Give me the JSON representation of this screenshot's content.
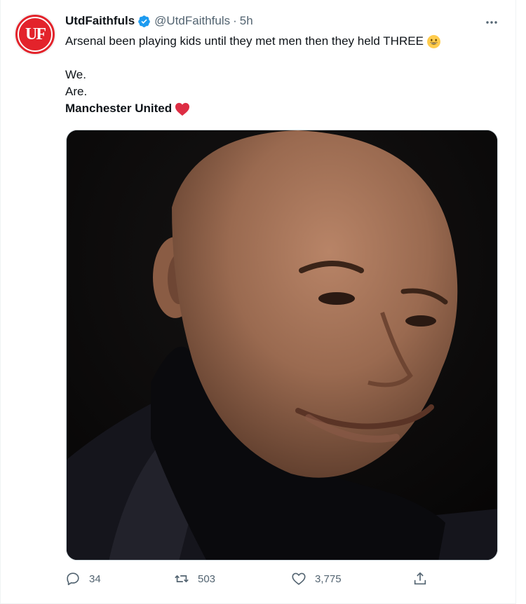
{
  "tweet": {
    "author": {
      "display_name": "UtdFaithfuls",
      "handle": "@UtdFaithfuls",
      "avatar_text": "UF",
      "verified": true
    },
    "separator": "·",
    "time": "5h",
    "text": {
      "line1": "Arsenal been playing kids until they met men then they held THREE",
      "line2": "We.",
      "line3": "Are.",
      "line4": "Manchester United"
    },
    "image_icon": "smirking-bald-man-photo",
    "actions": {
      "replies": "34",
      "retweets": "503",
      "likes": "3,775"
    }
  },
  "colors": {
    "brand_red": "#e3232b",
    "verified_blue": "#1d9bf0",
    "muted_text": "#536471",
    "heart_red": "#e0245e"
  }
}
